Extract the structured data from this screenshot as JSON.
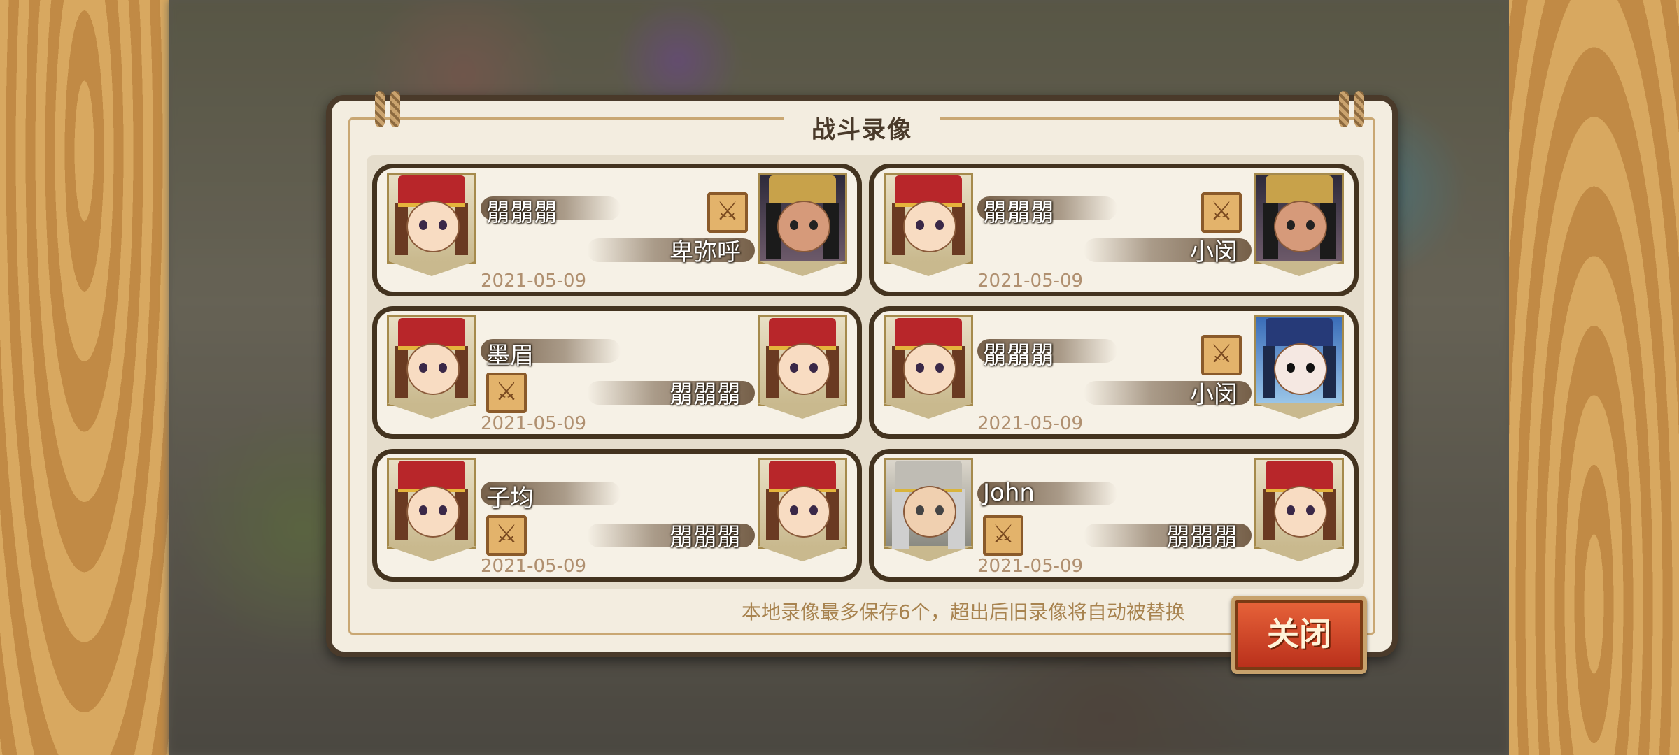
{
  "dialog": {
    "title": "战斗录像",
    "tip": "本地录像最多保存6个，超出后旧录像将自动被替换",
    "close_label": "关闭"
  },
  "records": [
    {
      "left_name": "朤朤朤",
      "right_name": "卑弥呼",
      "date": "2021-05-09",
      "winner": "right"
    },
    {
      "left_name": "朤朤朤",
      "right_name": "小闵",
      "date": "2021-05-09",
      "winner": "right"
    },
    {
      "left_name": "墨眉",
      "right_name": "朤朤朤",
      "date": "2021-05-09",
      "winner": "left"
    },
    {
      "left_name": "朤朤朤",
      "right_name": "小闵",
      "date": "2021-05-09",
      "winner": "right"
    },
    {
      "left_name": "子均",
      "right_name": "朤朤朤",
      "date": "2021-05-09",
      "winner": "left"
    },
    {
      "left_name": "John",
      "right_name": "朤朤朤",
      "date": "2021-05-09",
      "winner": "left"
    }
  ],
  "icons": {
    "win_badge": "crossed-swords-icon"
  }
}
